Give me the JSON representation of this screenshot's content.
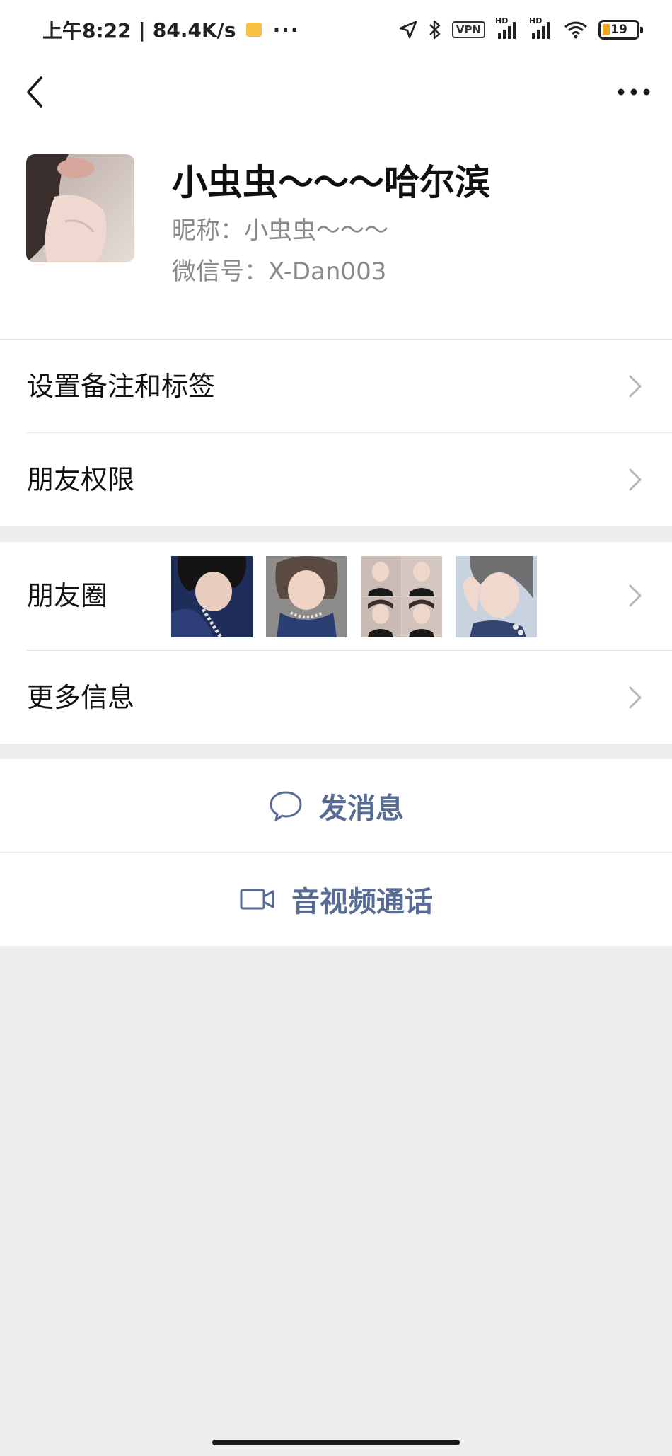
{
  "status_bar": {
    "time": "上午8:22",
    "separator": "|",
    "net_speed": "84.4K/s",
    "more_dots": "···",
    "vpn": "VPN",
    "hd1": "HD",
    "hd2": "HD",
    "battery": "19"
  },
  "nav": {
    "back_icon": "chevron-left-icon",
    "more_icon": "ellipsis-icon"
  },
  "profile": {
    "display_name": "小虫虫～～～哈尔滨",
    "nickname": "昵称：小虫虫～～～",
    "wechat_id": "微信号：X-Dan003"
  },
  "menu": {
    "set_remark": "设置备注和标签",
    "permissions": "朋友权限",
    "moments": "朋友圈",
    "more_info": "更多信息"
  },
  "actions": {
    "send_message": "发消息",
    "av_call": "音视频通话"
  },
  "colors": {
    "accent": "#576b95",
    "background": "#ededed",
    "cell": "#ffffff"
  }
}
